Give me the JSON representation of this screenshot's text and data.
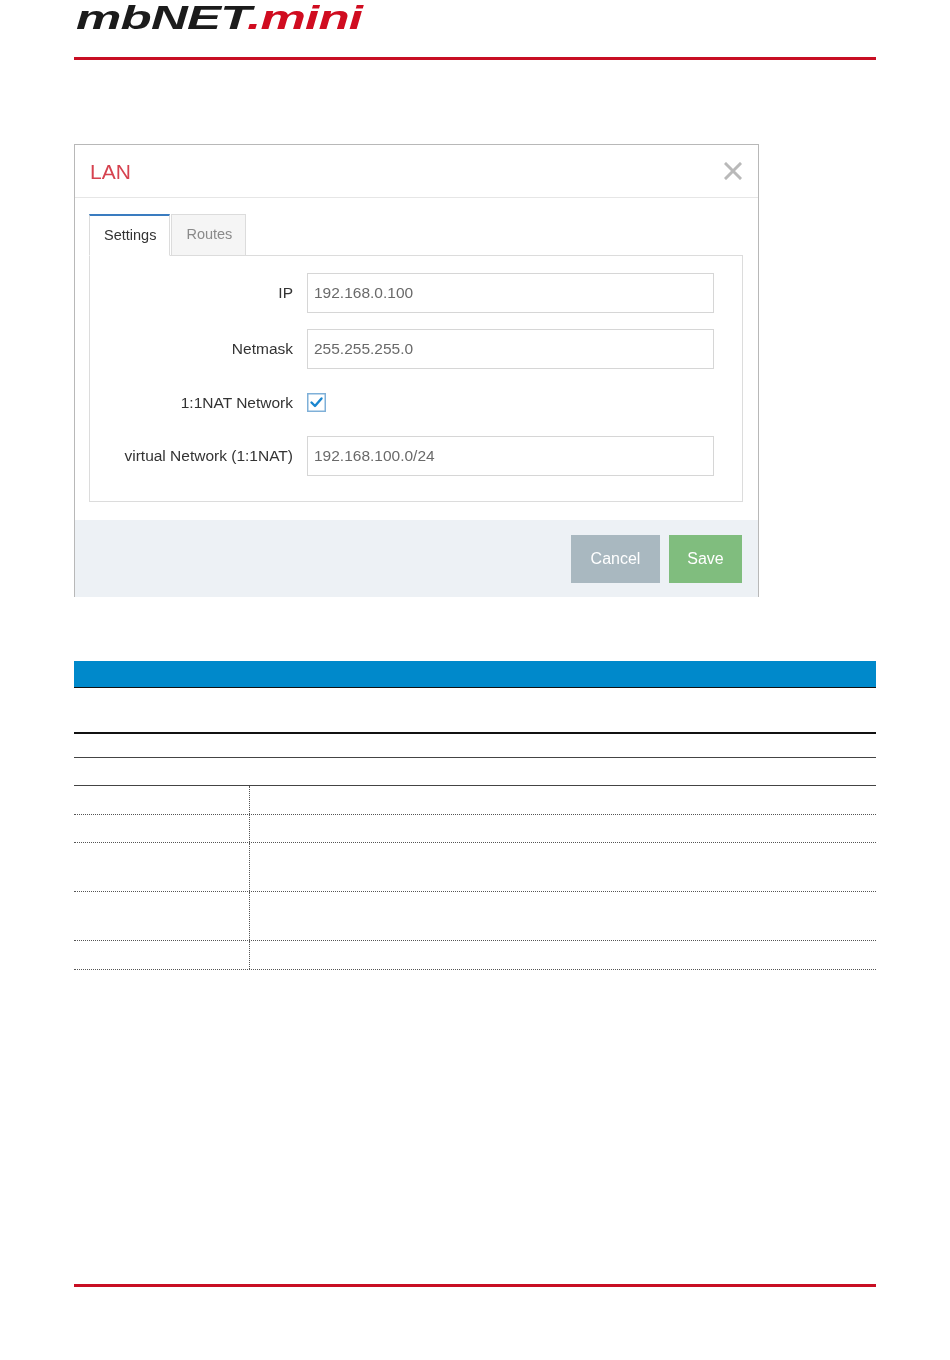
{
  "header": {
    "logo": {
      "brand": "mbNET",
      "suffix": ".mini"
    }
  },
  "dialog": {
    "title": "LAN",
    "tabs": [
      {
        "label": "Settings",
        "selected": true
      },
      {
        "label": "Routes",
        "selected": false
      }
    ],
    "fields": [
      {
        "kind": "text",
        "label": "IP",
        "value": "192.168.0.100"
      },
      {
        "kind": "text",
        "label": "Netmask",
        "value": "255.255.255.0"
      },
      {
        "kind": "checkbox",
        "label": "1:1NAT Network",
        "checked": true
      },
      {
        "kind": "text",
        "label": "virtual Network (1:1NAT)",
        "value": "192.168.100.0/24"
      }
    ],
    "buttons": [
      {
        "kind": "secondary",
        "label": "Cancel"
      },
      {
        "kind": "primary",
        "label": "Save"
      }
    ]
  }
}
